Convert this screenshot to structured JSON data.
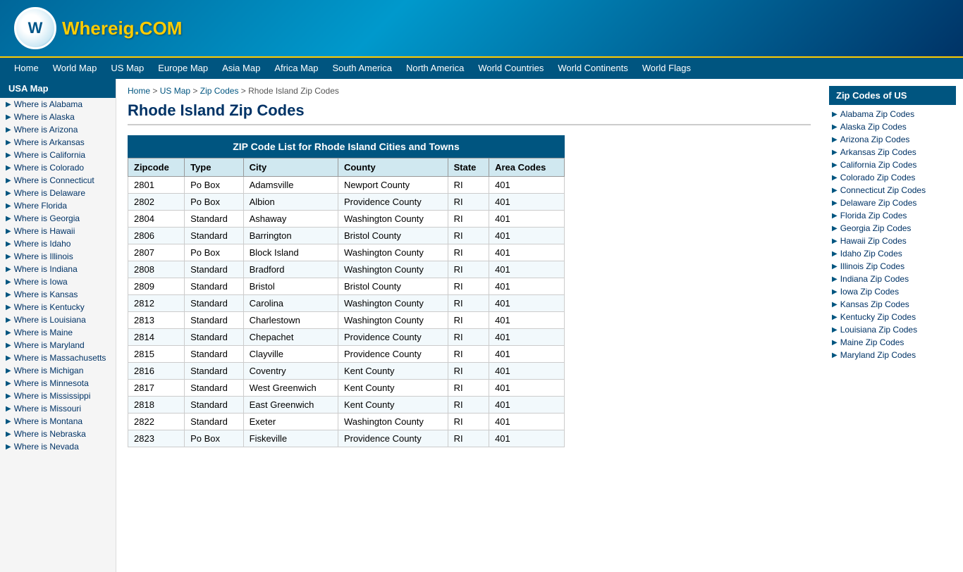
{
  "header": {
    "logo_letter": "W",
    "logo_text": "Whereig",
    "logo_tld": ".COM"
  },
  "nav": {
    "items": [
      {
        "label": "Home",
        "href": "#"
      },
      {
        "label": "World Map",
        "href": "#"
      },
      {
        "label": "US Map",
        "href": "#"
      },
      {
        "label": "Europe Map",
        "href": "#"
      },
      {
        "label": "Asia Map",
        "href": "#"
      },
      {
        "label": "Africa Map",
        "href": "#"
      },
      {
        "label": "South America",
        "href": "#"
      },
      {
        "label": "North America",
        "href": "#"
      },
      {
        "label": "World Countries",
        "href": "#"
      },
      {
        "label": "World Continents",
        "href": "#"
      },
      {
        "label": "World Flags",
        "href": "#"
      }
    ]
  },
  "sidebar": {
    "title": "USA Map",
    "items": [
      {
        "label": "Where is Alabama"
      },
      {
        "label": "Where is Alaska"
      },
      {
        "label": "Where is Arizona"
      },
      {
        "label": "Where is Arkansas"
      },
      {
        "label": "Where is California"
      },
      {
        "label": "Where is Colorado"
      },
      {
        "label": "Where is Connecticut"
      },
      {
        "label": "Where is Delaware"
      },
      {
        "label": "Where Florida"
      },
      {
        "label": "Where is Georgia"
      },
      {
        "label": "Where is Hawaii"
      },
      {
        "label": "Where is Idaho"
      },
      {
        "label": "Where is Illinois"
      },
      {
        "label": "Where is Indiana"
      },
      {
        "label": "Where is Iowa"
      },
      {
        "label": "Where is Kansas"
      },
      {
        "label": "Where is Kentucky"
      },
      {
        "label": "Where is Louisiana"
      },
      {
        "label": "Where is Maine"
      },
      {
        "label": "Where is Maryland"
      },
      {
        "label": "Where is Massachusetts"
      },
      {
        "label": "Where is Michigan"
      },
      {
        "label": "Where is Minnesota"
      },
      {
        "label": "Where is Mississippi"
      },
      {
        "label": "Where is Missouri"
      },
      {
        "label": "Where is Montana"
      },
      {
        "label": "Where is Nebraska"
      },
      {
        "label": "Where is Nevada"
      }
    ]
  },
  "breadcrumb": {
    "home": "Home",
    "us_map": "US Map",
    "zip_codes": "Zip Codes",
    "current": "Rhode Island Zip Codes"
  },
  "page_title": "Rhode Island Zip Codes",
  "table": {
    "caption": "ZIP Code List for Rhode Island Cities and Towns",
    "headers": [
      "Zipcode",
      "Type",
      "City",
      "County",
      "State",
      "Area Codes"
    ],
    "rows": [
      [
        "2801",
        "Po Box",
        "Adamsville",
        "Newport County",
        "RI",
        "401"
      ],
      [
        "2802",
        "Po Box",
        "Albion",
        "Providence County",
        "RI",
        "401"
      ],
      [
        "2804",
        "Standard",
        "Ashaway",
        "Washington County",
        "RI",
        "401"
      ],
      [
        "2806",
        "Standard",
        "Barrington",
        "Bristol County",
        "RI",
        "401"
      ],
      [
        "2807",
        "Po Box",
        "Block Island",
        "Washington County",
        "RI",
        "401"
      ],
      [
        "2808",
        "Standard",
        "Bradford",
        "Washington County",
        "RI",
        "401"
      ],
      [
        "2809",
        "Standard",
        "Bristol",
        "Bristol County",
        "RI",
        "401"
      ],
      [
        "2812",
        "Standard",
        "Carolina",
        "Washington County",
        "RI",
        "401"
      ],
      [
        "2813",
        "Standard",
        "Charlestown",
        "Washington County",
        "RI",
        "401"
      ],
      [
        "2814",
        "Standard",
        "Chepachet",
        "Providence County",
        "RI",
        "401"
      ],
      [
        "2815",
        "Standard",
        "Clayville",
        "Providence County",
        "RI",
        "401"
      ],
      [
        "2816",
        "Standard",
        "Coventry",
        "Kent County",
        "RI",
        "401"
      ],
      [
        "2817",
        "Standard",
        "West Greenwich",
        "Kent County",
        "RI",
        "401"
      ],
      [
        "2818",
        "Standard",
        "East Greenwich",
        "Kent County",
        "RI",
        "401"
      ],
      [
        "2822",
        "Standard",
        "Exeter",
        "Washington County",
        "RI",
        "401"
      ],
      [
        "2823",
        "Po Box",
        "Fiskeville",
        "Providence County",
        "RI",
        "401"
      ]
    ]
  },
  "right_panel": {
    "title": "Zip Codes of US",
    "items": [
      {
        "label": "Alabama Zip Codes"
      },
      {
        "label": "Alaska Zip Codes"
      },
      {
        "label": "Arizona Zip Codes"
      },
      {
        "label": "Arkansas Zip Codes"
      },
      {
        "label": "California Zip Codes"
      },
      {
        "label": "Colorado Zip Codes"
      },
      {
        "label": "Connecticut Zip Codes"
      },
      {
        "label": "Delaware Zip Codes"
      },
      {
        "label": "Florida Zip Codes"
      },
      {
        "label": "Georgia Zip Codes"
      },
      {
        "label": "Hawaii Zip Codes"
      },
      {
        "label": "Idaho Zip Codes"
      },
      {
        "label": "Illinois Zip Codes"
      },
      {
        "label": "Indiana Zip Codes"
      },
      {
        "label": "Iowa Zip Codes"
      },
      {
        "label": "Kansas Zip Codes"
      },
      {
        "label": "Kentucky Zip Codes"
      },
      {
        "label": "Louisiana Zip Codes"
      },
      {
        "label": "Maine Zip Codes"
      },
      {
        "label": "Maryland Zip Codes"
      }
    ]
  }
}
